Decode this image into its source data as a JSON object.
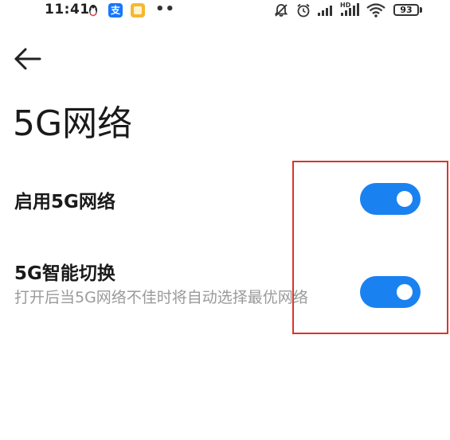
{
  "status_bar": {
    "time": "11:41",
    "alipay_glyph": "支",
    "more_dots": "••",
    "battery_level": "93",
    "left_icons": [
      "qq-icon",
      "alipay-icon",
      "notes-icon"
    ],
    "right_icons": [
      "mute-icon",
      "alarm-icon",
      "signal-icon",
      "hd-signal-icon",
      "wifi-icon",
      "battery-icon"
    ]
  },
  "header": {
    "back_icon": "arrow-left-icon",
    "title": "5G网络"
  },
  "settings": [
    {
      "title": "启用5G网络",
      "description": "",
      "enabled": true
    },
    {
      "title": "5G智能切换",
      "description": "打开后当5G网络不佳时将自动选择最优网络",
      "enabled": true
    }
  ],
  "colors": {
    "toggle_on": "#1a82f0",
    "highlight_border": "#d9342b",
    "description_text": "#9a9a9a"
  }
}
